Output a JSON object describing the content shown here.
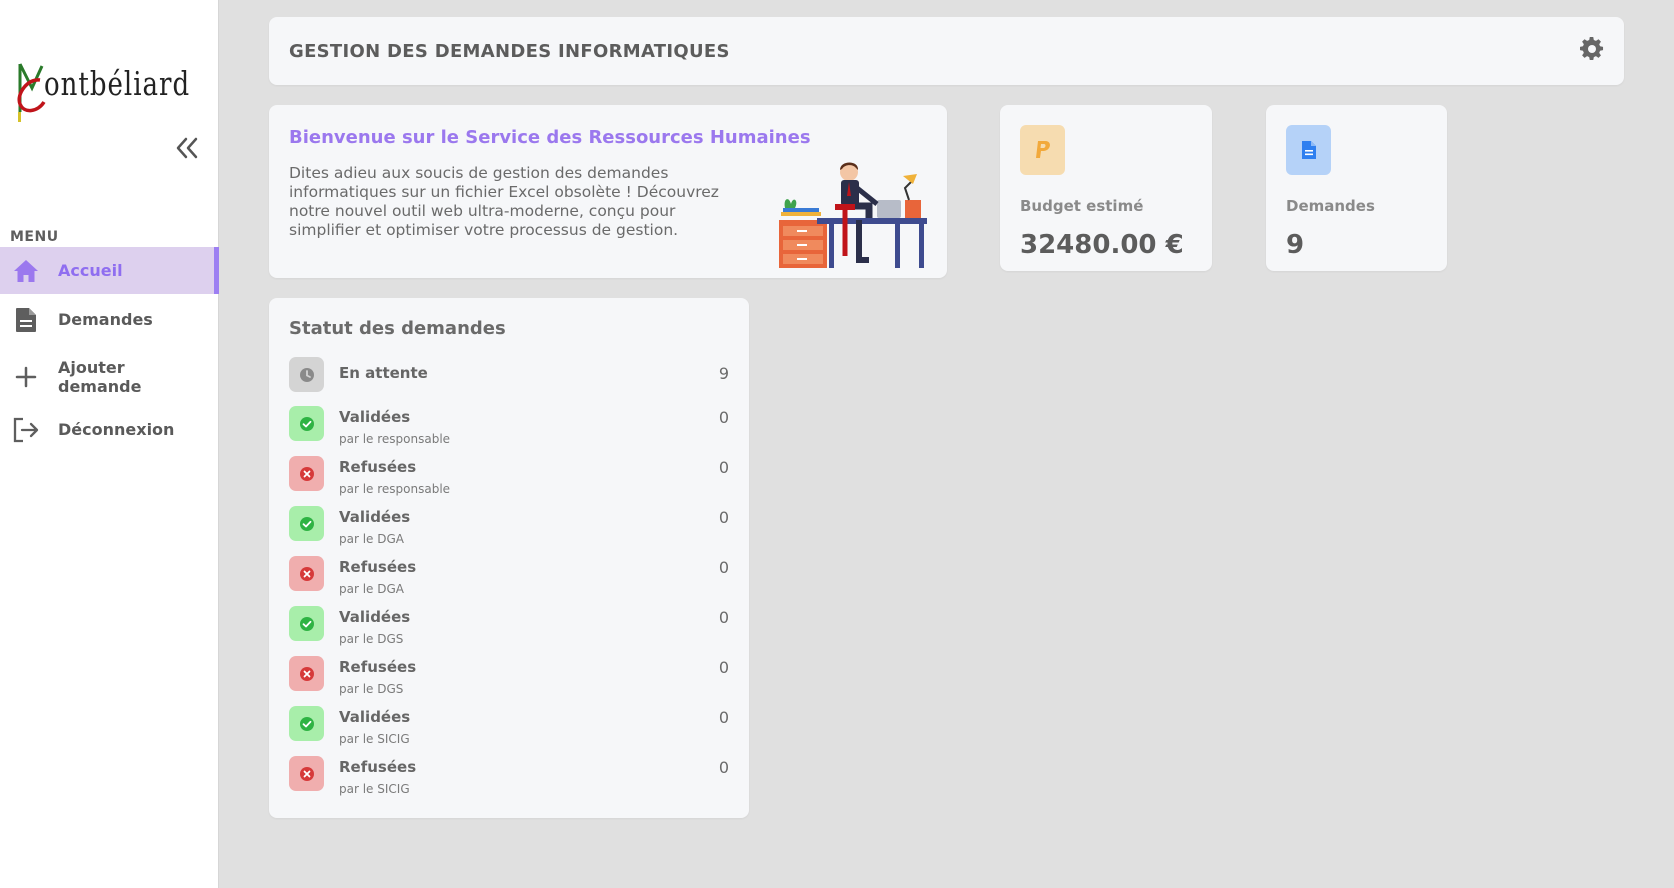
{
  "sidebar": {
    "logo_text": "ontbéliard",
    "menu_title": "MENU",
    "items": [
      {
        "label": "Accueil",
        "icon": "home-icon",
        "active": true
      },
      {
        "label": "Demandes",
        "icon": "document-icon",
        "active": false
      },
      {
        "label": "Ajouter demande",
        "label_line1": "Ajouter",
        "label_line2": "demande",
        "icon": "plus-icon",
        "active": false
      },
      {
        "label": "Déconnexion",
        "icon": "logout-icon",
        "active": false
      }
    ]
  },
  "header": {
    "title": "GESTION DES DEMANDES INFORMATIQUES"
  },
  "welcome": {
    "title": "Bienvenue sur le Service des Ressources Humaines",
    "text": "Dites adieu aux soucis de gestion des demandes informatiques sur un fichier Excel obsolète ! Découvrez notre nouvel outil web ultra-moderne, conçu pour simplifier et optimiser votre processus de gestion."
  },
  "kpis": [
    {
      "label": "Budget estimé",
      "value": "32480.00 €",
      "icon": "paypal-icon",
      "icon_bg": "#f6dcb0",
      "icon_color": "#f2a93b"
    },
    {
      "label": "Demandes",
      "value": "9",
      "icon": "document-icon",
      "icon_bg": "#b5d2f8",
      "icon_color": "#2e7ff0"
    }
  ],
  "status": {
    "title": "Statut des demandes",
    "rows": [
      {
        "name": "En attente",
        "sub": "",
        "count": "9",
        "kind": "wait"
      },
      {
        "name": "Validées",
        "sub": "par le responsable",
        "count": "0",
        "kind": "ok"
      },
      {
        "name": "Refusées",
        "sub": "par le responsable",
        "count": "0",
        "kind": "ko"
      },
      {
        "name": "Validées",
        "sub": "par le DGA",
        "count": "0",
        "kind": "ok"
      },
      {
        "name": "Refusées",
        "sub": "par le DGA",
        "count": "0",
        "kind": "ko"
      },
      {
        "name": "Validées",
        "sub": "par le DGS",
        "count": "0",
        "kind": "ok"
      },
      {
        "name": "Refusées",
        "sub": "par le DGS",
        "count": "0",
        "kind": "ko"
      },
      {
        "name": "Validées",
        "sub": "par le SICIG",
        "count": "0",
        "kind": "ok"
      },
      {
        "name": "Refusées",
        "sub": "par le SICIG",
        "count": "0",
        "kind": "ko"
      }
    ]
  },
  "colors": {
    "accent": "#9b78ee",
    "active_bg": "#ddd0ee",
    "ok_icon": "#2fb344",
    "ko_icon": "#d63939",
    "wait_icon": "#8a8a8a"
  }
}
